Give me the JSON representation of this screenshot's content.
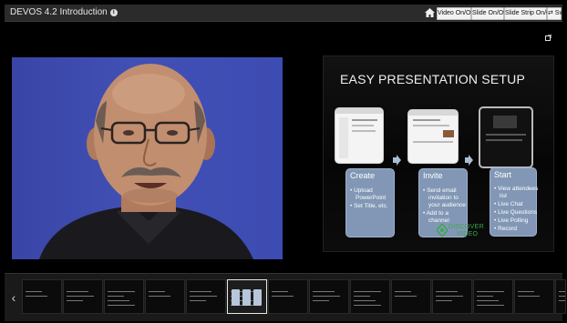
{
  "header": {
    "title": "DEVOS 4.2 Introduction",
    "buttons": {
      "video": "Video On/Off",
      "slide": "Slide On/Off",
      "strip": "Slide Strip On/Off",
      "swap": "⇄ Swap"
    }
  },
  "slide": {
    "title": "EASY PRESENTATION SETUP",
    "panels": [
      {
        "title": "Create",
        "items": [
          "• Upload",
          "PowerPoint",
          "• Set Title, etc."
        ]
      },
      {
        "title": "Invite",
        "items": [
          "• Send email",
          "invitation to",
          "your audience",
          "• Add to a",
          "channel"
        ]
      },
      {
        "title": "Start",
        "items": [
          "• View attendees",
          "list",
          "• Live Chat",
          "• Live Questions",
          "• Live Polling",
          "• Record"
        ]
      }
    ],
    "logo": {
      "line1": "DISCOVER",
      "line2": "VIDEO"
    }
  },
  "strip": {
    "thumbnails": 14,
    "active_index": 5
  },
  "icons": [
    "info-icon",
    "home-icon",
    "expand-icon",
    "chevron-left-icon",
    "arrow-right-icon"
  ],
  "colors": {
    "accent": "#3aa94a",
    "panel": "#8ca4c4"
  }
}
